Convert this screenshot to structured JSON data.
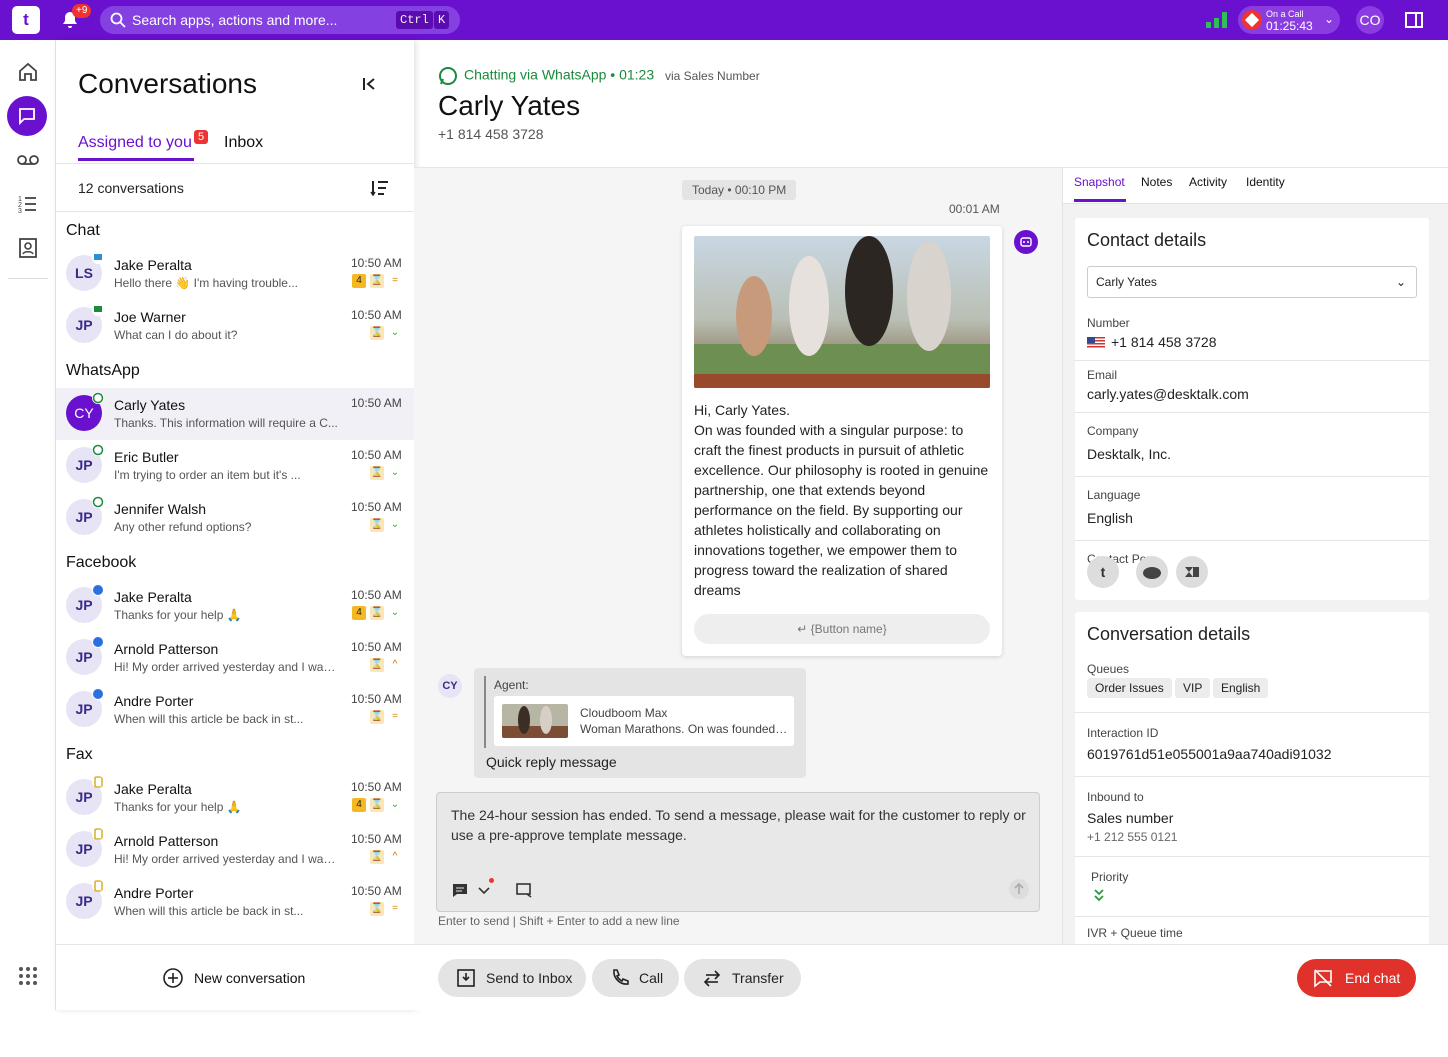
{
  "topbar": {
    "logo_text": "t",
    "notifications_badge": "+9",
    "search_placeholder": "Search apps, actions and more...",
    "kbd_ctrl": "Ctrl",
    "kbd_k": "K",
    "call_status": "On a Call",
    "call_timer": "01:25:43",
    "user_initials": "CO"
  },
  "conversations": {
    "title": "Conversations",
    "tab_assigned": "Assigned to you",
    "tab_assigned_badge": "5",
    "tab_inbox": "Inbox",
    "count_label": "12 conversations",
    "sections": {
      "chat": "Chat",
      "whatsapp": "WhatsApp",
      "facebook": "Facebook",
      "fax": "Fax"
    },
    "rows": [
      {
        "initials": "LS",
        "name": "Jake Peralta",
        "preview": "Hello there 👋 I'm having trouble...",
        "time": "10:50 AM",
        "count": "4",
        "priority": "="
      },
      {
        "initials": "JP",
        "name": "Joe Warner",
        "preview": "What can I do about it?",
        "time": "10:50 AM",
        "priority": "⌄"
      },
      {
        "initials": "CY",
        "name": "Carly Yates",
        "preview": "Thanks. This information will require a C...",
        "time": "10:50 AM"
      },
      {
        "initials": "JP",
        "name": "Eric Butler",
        "preview": "I'm trying to order an item but it's ...",
        "time": "10:50 AM",
        "priority": "⌄"
      },
      {
        "initials": "JP",
        "name": "Jennifer Walsh",
        "preview": "Any other refund options?",
        "time": "10:50 AM",
        "priority": "⌄"
      },
      {
        "initials": "JP",
        "name": "Jake Peralta",
        "preview": "Thanks for your help 🙏",
        "time": "10:50 AM",
        "count": "4",
        "priority": "⌄"
      },
      {
        "initials": "JP",
        "name": "Arnold Patterson",
        "preview": "Hi! My order arrived yesterday and I was...",
        "time": "10:50 AM",
        "priority": "^"
      },
      {
        "initials": "JP",
        "name": "Andre Porter",
        "preview": "When will this article be back in st...",
        "time": "10:50 AM",
        "priority": "="
      },
      {
        "initials": "JP",
        "name": "Jake Peralta",
        "preview": "Thanks for your help 🙏",
        "time": "10:50 AM",
        "count": "4",
        "priority": "⌄"
      },
      {
        "initials": "JP",
        "name": "Arnold Patterson",
        "preview": "Hi! My order arrived yesterday and I was...",
        "time": "10:50 AM",
        "priority": "^"
      },
      {
        "initials": "JP",
        "name": "Andre Porter",
        "preview": "When will this article be back in st...",
        "time": "10:50 AM",
        "priority": "="
      }
    ],
    "hourglass": "⌛",
    "new_conversation": "New conversation"
  },
  "header": {
    "channel": "Chatting via WhatsApp • 01:23",
    "via": "via Sales Number",
    "name": "Carly Yates",
    "number": "+1 814 458 3728"
  },
  "chat": {
    "date_pill": "Today • 00:10 PM",
    "message_time": "00:01  AM",
    "card_text": "Hi, Carly Yates.\nOn was founded with a singular purpose: to craft the finest products in pursuit of athletic excellence. Our philosophy is rooted in genuine partnership, one that extends beyond performance on the field. By supporting our athletes holistically and collaborating on innovations together, we empower them to progress toward the realization of shared dreams",
    "card_button": "↵  {Button name}",
    "customer_initials": "CY",
    "quote_agent": "Agent:",
    "quote_title": "Cloudboom Max",
    "quote_subtitle": "Woman Marathons. On was founded with a singular purpose",
    "quick_reply": "Quick reply message",
    "composer_text": "The 24-hour session has ended. To send a message, please wait for the customer to reply or use a pre-approve template message.",
    "hint": "Enter to send | Shift + Enter to add a new line"
  },
  "actions": {
    "send_to_inbox": "Send to Inbox",
    "call": "Call",
    "transfer": "Transfer",
    "end_chat": "End chat"
  },
  "right": {
    "tabs": [
      "Snapshot",
      "Notes",
      "Activity",
      "Identity"
    ],
    "contact": {
      "title": "Contact details",
      "selected": "Carly Yates",
      "number_label": "Number",
      "number": "+1 814 458 3728",
      "email_label": "Email",
      "email": "carly.yates@desktalk.com",
      "company_label": "Company",
      "company": "Desktalk, Inc.",
      "language_label": "Language",
      "language": "English",
      "pop_label": "Contact Pop"
    },
    "conversation": {
      "title": "Conversation details",
      "queues_label": "Queues",
      "queues": [
        "Order Issues",
        "VIP",
        "English"
      ],
      "interaction_label": "Interaction ID",
      "interaction": "6019761d51e055001a9aa740adi91032",
      "inbound_label": "Inbound to",
      "inbound": "Sales number",
      "inbound_number": "+1 212 555 0121",
      "priority_label": "Priority",
      "ivr_label": "IVR + Queue time"
    }
  },
  "colors": {
    "brand": "#6a10cf",
    "whatsapp": "#1a8a3c",
    "danger": "#e0322a"
  }
}
